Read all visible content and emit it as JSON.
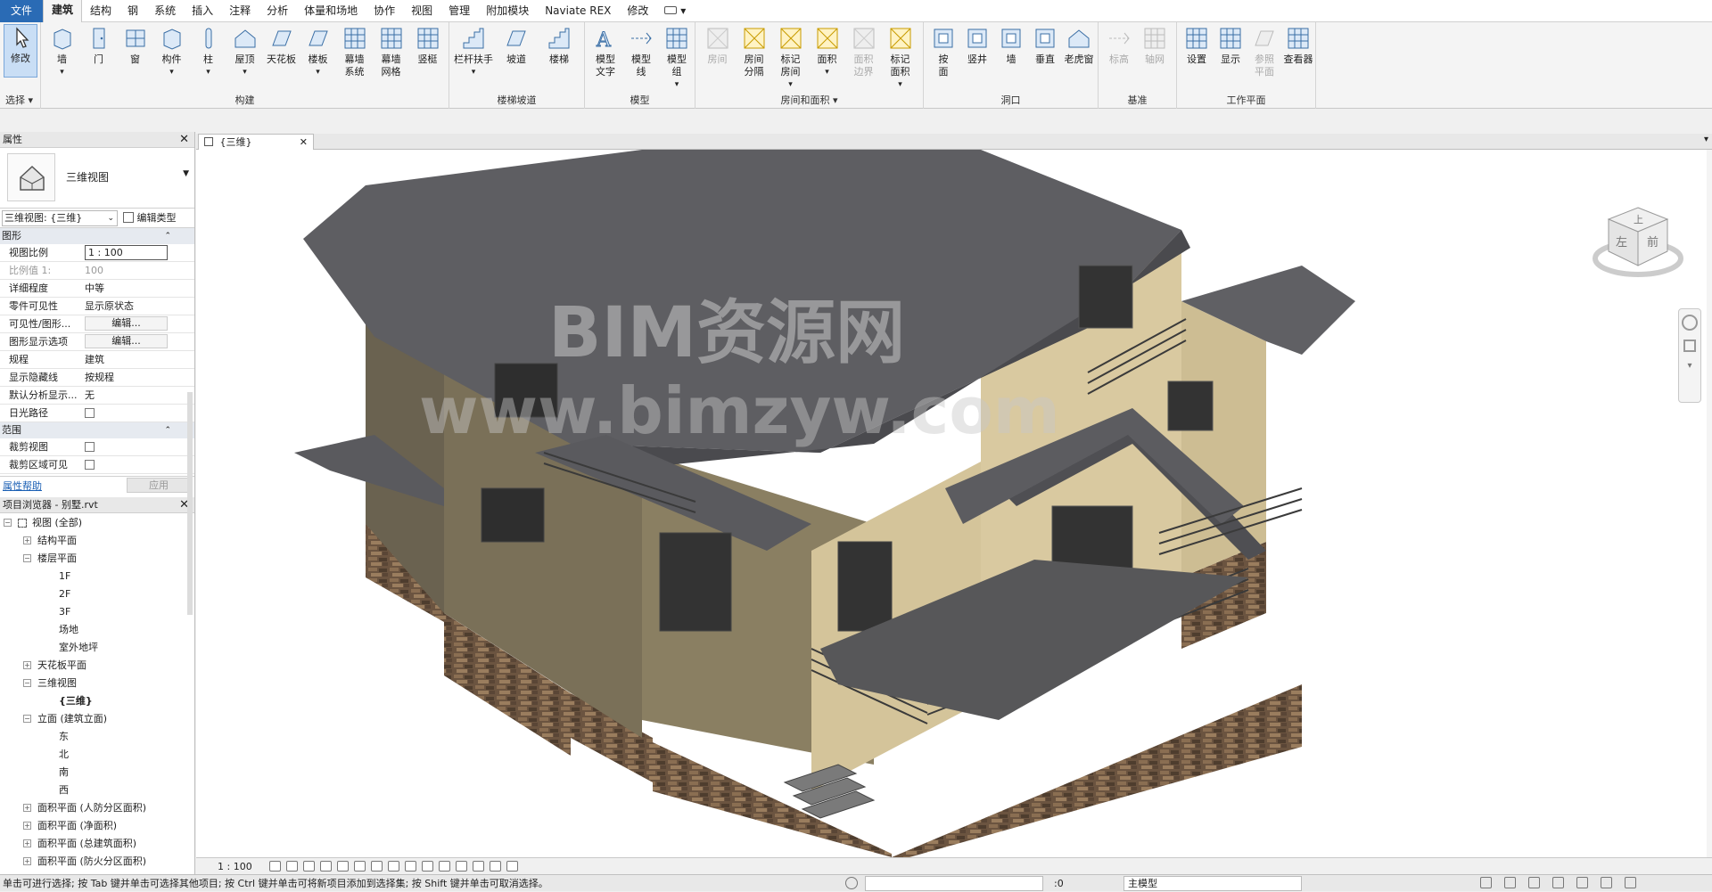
{
  "menubar": {
    "items": [
      "文件",
      "建筑",
      "结构",
      "钢",
      "系统",
      "插入",
      "注释",
      "分析",
      "体量和场地",
      "协作",
      "视图",
      "管理",
      "附加模块",
      "Naviate REX",
      "修改"
    ]
  },
  "ribbon": {
    "select_label": "选择",
    "select_dropdown": "▾",
    "modify": "修改",
    "build": {
      "title": "构建",
      "tools": [
        "墙",
        "门",
        "窗",
        "构件",
        "柱",
        "屋顶",
        "天花板",
        "楼板",
        "幕墙\n系统",
        "幕墙\n网格",
        "竖梃"
      ]
    },
    "stairs": {
      "title": "楼梯坡道",
      "tools": [
        "栏杆扶手",
        "坡道",
        "楼梯"
      ]
    },
    "model": {
      "title": "模型",
      "tools": [
        "模型\n文字",
        "模型\n线",
        "模型\n组"
      ]
    },
    "room": {
      "title": "房间和面积",
      "tools": [
        "房间",
        "房间\n分隔",
        "标记\n房间",
        "面积",
        "面积\n边界",
        "标记\n面积"
      ]
    },
    "opening": {
      "title": "洞口",
      "tools": [
        "按\n面",
        "竖井",
        "墙",
        "垂直",
        "老虎窗"
      ]
    },
    "datum": {
      "title": "基准",
      "tools": [
        "标高",
        "轴网"
      ]
    },
    "workplane": {
      "title": "工作平面",
      "tools": [
        "设置",
        "显示",
        "参照\n平面",
        "查看器"
      ]
    }
  },
  "doc_tab": {
    "label": "{三维}",
    "close": "✕"
  },
  "properties": {
    "title": "属性",
    "type_name": "三维视图",
    "view_selector": "三维视图: {三维}",
    "edit_type": "编辑类型",
    "groups": {
      "graphics": "图形",
      "extents": "范围"
    },
    "rows": [
      {
        "k": "视图比例",
        "v": "1 : 100"
      },
      {
        "k": "比例值 1:",
        "v": "100",
        "dis": true
      },
      {
        "k": "详细程度",
        "v": "中等"
      },
      {
        "k": "零件可见性",
        "v": "显示原状态"
      },
      {
        "k": "可见性/图形...",
        "v": "编辑..."
      },
      {
        "k": "图形显示选项",
        "v": "编辑..."
      },
      {
        "k": "规程",
        "v": "建筑"
      },
      {
        "k": "显示隐藏线",
        "v": "按规程"
      },
      {
        "k": "默认分析显示...",
        "v": "无"
      },
      {
        "k": "日光路径",
        "v": ""
      }
    ],
    "extent_rows": [
      {
        "k": "裁剪视图",
        "v": ""
      },
      {
        "k": "裁剪区域可见",
        "v": ""
      }
    ],
    "help": "属性帮助",
    "apply": "应用"
  },
  "browser": {
    "title": "项目浏览器 - 别墅.rvt",
    "items": [
      {
        "t": "视图 (全部)",
        "lvl": 0,
        "pm": "−",
        "root": true
      },
      {
        "t": "结构平面",
        "lvl": 1,
        "pm": "+"
      },
      {
        "t": "楼层平面",
        "lvl": 1,
        "pm": "−"
      },
      {
        "t": "1F",
        "lvl": 2
      },
      {
        "t": "2F",
        "lvl": 2
      },
      {
        "t": "3F",
        "lvl": 2
      },
      {
        "t": "场地",
        "lvl": 2
      },
      {
        "t": "室外地坪",
        "lvl": 2
      },
      {
        "t": "天花板平面",
        "lvl": 1,
        "pm": "+"
      },
      {
        "t": "三维视图",
        "lvl": 1,
        "pm": "−"
      },
      {
        "t": "{三维}",
        "lvl": 2,
        "bold": true
      },
      {
        "t": "立面 (建筑立面)",
        "lvl": 1,
        "pm": "−"
      },
      {
        "t": "东",
        "lvl": 2
      },
      {
        "t": "北",
        "lvl": 2
      },
      {
        "t": "南",
        "lvl": 2
      },
      {
        "t": "西",
        "lvl": 2
      },
      {
        "t": "面积平面 (人防分区面积)",
        "lvl": 1,
        "pm": "+"
      },
      {
        "t": "面积平面 (净面积)",
        "lvl": 1,
        "pm": "+"
      },
      {
        "t": "面积平面 (总建筑面积)",
        "lvl": 1,
        "pm": "+"
      },
      {
        "t": "面积平面 (防火分区面积)",
        "lvl": 1,
        "pm": "+"
      }
    ]
  },
  "viewcube": {
    "top": "上",
    "left": "左",
    "front": "前"
  },
  "watermark": {
    "line1": "BIM资源网",
    "line2": "www.bimzyw.com"
  },
  "viewbar": {
    "scale": "1 : 100"
  },
  "status": {
    "message": "单击可进行选择; 按 Tab 键并单击可选择其他项目; 按 Ctrl 键并单击可将新项目添加到选择集; 按 Shift 键并单击可取消选择。",
    "zero": ":0",
    "model": "主模型"
  }
}
